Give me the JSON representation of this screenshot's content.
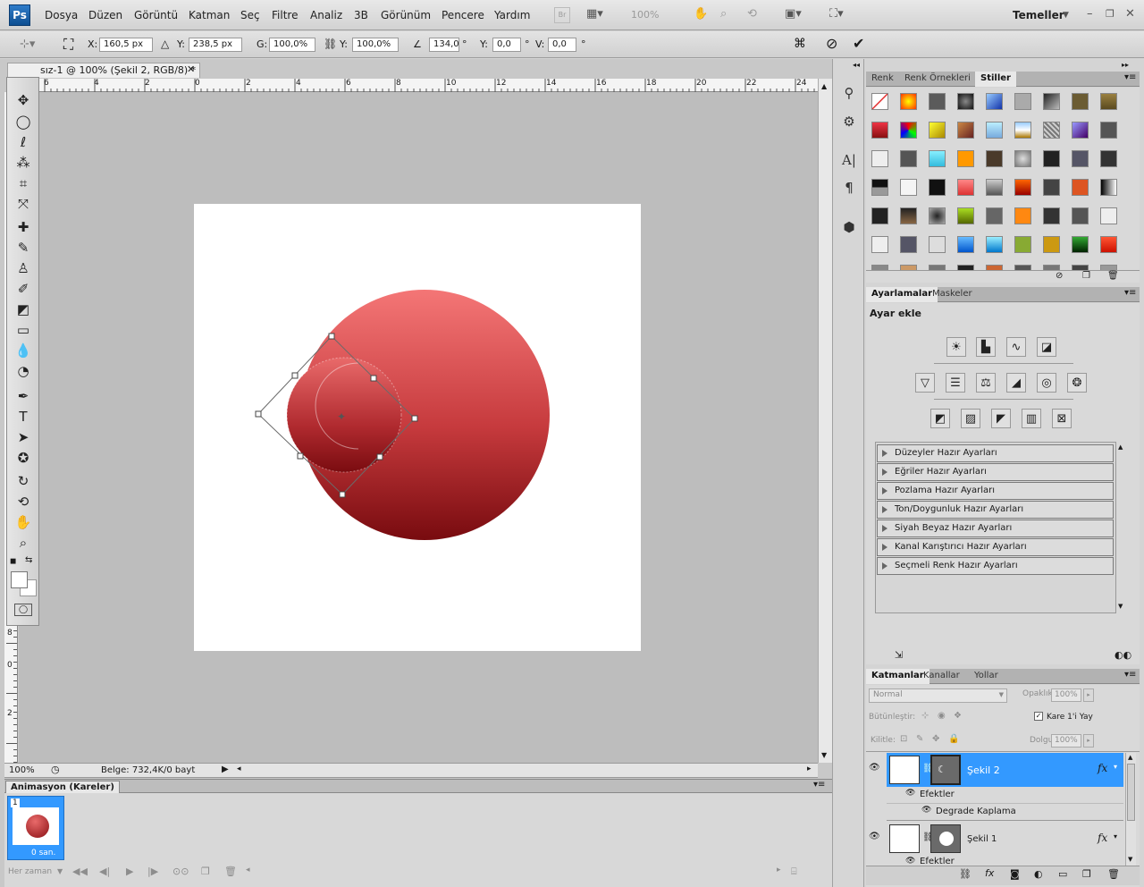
{
  "app": {
    "logo": "Ps"
  },
  "menu": [
    "Dosya",
    "Düzen",
    "Görüntü",
    "Katman",
    "Seç",
    "Filtre",
    "Analiz",
    "3B",
    "Görünüm",
    "Pencere",
    "Yardım"
  ],
  "menubar_right": {
    "bridge": "Br",
    "zoom": "100%",
    "workspace": "Temeller"
  },
  "options": {
    "x_label": "X:",
    "x_value": "160,5 px",
    "y_label": "Y:",
    "y_value": "238,5 px",
    "w_label": "G:",
    "w_value": "100,0%",
    "h_label": "Y:",
    "h_value": "100,0%",
    "angle_value": "134,0",
    "angle_unit": "°",
    "hskew_label": "Y:",
    "hskew_value": "0,0",
    "hskew_unit": "°",
    "vskew_label": "V:",
    "vskew_value": "0,0",
    "vskew_unit": "°"
  },
  "document": {
    "tab_title": "sız-1 @ 100% (Şekil 2, RGB/8) *",
    "ruler_h": [
      "6",
      "4",
      "2",
      "0",
      "2",
      "4",
      "6",
      "8",
      "10",
      "12",
      "14",
      "16",
      "18",
      "20",
      "22",
      "24"
    ],
    "ruler_v": [
      "2",
      "4",
      "6",
      "8",
      "0",
      "2"
    ],
    "zoom": "100%",
    "info": "Belge: 732,4K/0 bayt"
  },
  "animation": {
    "title": "Animasyon (Kareler)",
    "frame_number": "1",
    "frame_delay": "0 san.",
    "loop": "Her zaman"
  },
  "styles_panel": {
    "tabs": [
      "Renk",
      "Renk Örnekleri",
      "Stiller"
    ],
    "active_tab": "Stiller"
  },
  "adjust_panel": {
    "tabs": [
      "Ayarlamalar",
      "Maskeler"
    ],
    "header": "Ayar ekle",
    "presets": [
      "Düzeyler Hazır Ayarları",
      "Eğriler Hazır Ayarları",
      "Pozlama Hazır Ayarları",
      "Ton/Doygunluk Hazır Ayarları",
      "Siyah Beyaz Hazır Ayarları",
      "Kanal Karıştırıcı Hazır Ayarları",
      "Seçmeli Renk Hazır Ayarları"
    ]
  },
  "layers_panel": {
    "tabs": [
      "Katmanlar",
      "Kanallar",
      "Yollar"
    ],
    "blend_mode": "Normal",
    "opacity_label": "Opaklık:",
    "opacity_value": "100%",
    "unify_label": "Bütünleştir:",
    "propagate_label": "Kare 1'i Yay",
    "lock_label": "Kilitle:",
    "fill_label": "Dolgu:",
    "fill_value": "100%",
    "layers": [
      {
        "name": "Şekil 2",
        "effects_label": "Efektler",
        "effect": "Degrade Kaplama",
        "selected": true
      },
      {
        "name": "Şekil 1",
        "effects_label": "Efektler",
        "selected": false
      }
    ]
  },
  "colors": {
    "accent": "#3399ff",
    "circle_top": "#f07373",
    "circle_bottom": "#7a0a0d"
  }
}
